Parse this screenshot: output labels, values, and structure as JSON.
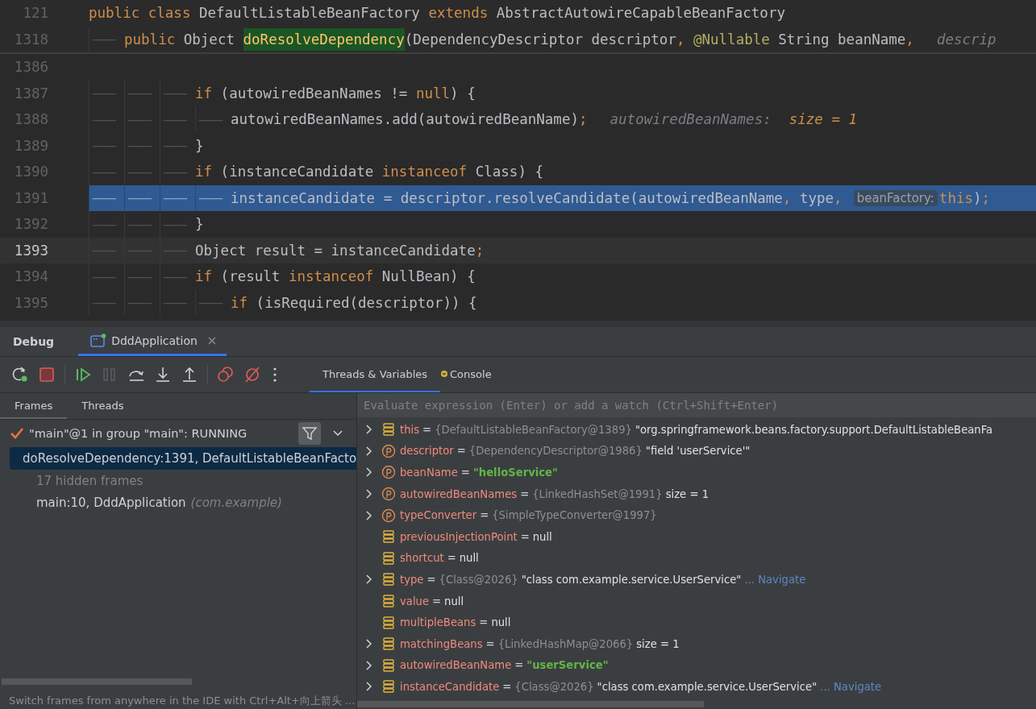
{
  "editor": {
    "sticky_lines": [
      {
        "number": "121",
        "tokens": [
          {
            "kind": "kw",
            "text": "public class "
          },
          {
            "kind": "plain",
            "text": "DefaultListableBeanFactory "
          },
          {
            "kind": "kw",
            "text": "extends "
          },
          {
            "kind": "plain",
            "text": "AbstractAutowireCapableBeanFactory"
          }
        ]
      },
      {
        "number": "1318",
        "indent_marks": [
          "——"
        ],
        "tokens": [
          {
            "kind": "kw",
            "text": "public "
          },
          {
            "kind": "plain",
            "text": "Object "
          },
          {
            "kind": "decl",
            "text": "doResolveDependency"
          },
          {
            "kind": "plain",
            "text": "(DependencyDescriptor descriptor"
          },
          {
            "kind": "punct",
            "text": ","
          },
          {
            "kind": "annot",
            "text": " @Nullable"
          },
          {
            "kind": "plain",
            "text": " String beanName"
          },
          {
            "kind": "punct",
            "text": ","
          },
          {
            "kind": "hint",
            "text": "descrip"
          }
        ]
      }
    ],
    "lines": [
      {
        "number": "1386",
        "current": false,
        "selected": false
      },
      {
        "number": "1387",
        "indent_marks": [
          "——",
          "——",
          "——"
        ],
        "current": false,
        "selected": false,
        "tokens": [
          {
            "kind": "kw",
            "text": "if "
          },
          {
            "kind": "plain",
            "text": "(autowiredBeanNames != "
          },
          {
            "kind": "kw",
            "text": "null"
          },
          {
            "kind": "plain",
            "text": ") {"
          }
        ]
      },
      {
        "number": "1388",
        "indent_marks": [
          "——",
          "——",
          "——",
          "——"
        ],
        "current": false,
        "selected": false,
        "tokens": [
          {
            "kind": "plain",
            "text": "autowiredBeanNames.add(autowiredBeanName)"
          },
          {
            "kind": "punct",
            "text": ";"
          },
          {
            "kind": "hint",
            "text": "autowiredBeanNames:"
          },
          {
            "kind": "hintval",
            "text": "size = 1"
          }
        ]
      },
      {
        "number": "1389",
        "indent_marks": [
          "——",
          "——",
          "——"
        ],
        "current": false,
        "selected": false,
        "tokens": [
          {
            "kind": "plain",
            "text": "}"
          }
        ]
      },
      {
        "number": "1390",
        "indent_marks": [
          "——",
          "——",
          "——"
        ],
        "current": false,
        "selected": false,
        "tokens": [
          {
            "kind": "kw",
            "text": "if "
          },
          {
            "kind": "plain",
            "text": "(instanceCandidate "
          },
          {
            "kind": "kw",
            "text": "instanceof "
          },
          {
            "kind": "plain",
            "text": "Class) {"
          }
        ]
      },
      {
        "number": "1391",
        "indent_marks": [
          "——",
          "——",
          "——",
          "——"
        ],
        "current": false,
        "selected": true,
        "tokens": [
          {
            "kind": "plain",
            "text": "instanceCandidate = descriptor.resolveCandidate(autowiredBeanName"
          },
          {
            "kind": "punct",
            "text": ","
          },
          {
            "kind": "plain",
            "text": " type"
          },
          {
            "kind": "punct",
            "text": ","
          },
          {
            "kind": "chip",
            "text": "beanFactory:"
          },
          {
            "kind": "kw",
            "text": "this"
          },
          {
            "kind": "plain",
            "text": ")"
          },
          {
            "kind": "punct",
            "text": ";"
          }
        ]
      },
      {
        "number": "1392",
        "indent_marks": [
          "——",
          "——",
          "——"
        ],
        "current": false,
        "selected": false,
        "tokens": [
          {
            "kind": "plain",
            "text": "}"
          }
        ]
      },
      {
        "number": "1393",
        "indent_marks": [
          "——",
          "——",
          "——"
        ],
        "current": true,
        "selected": false,
        "tokens": [
          {
            "kind": "plain",
            "text": "Object result = instanceCandidate"
          },
          {
            "kind": "punct",
            "text": ";"
          }
        ]
      },
      {
        "number": "1394",
        "indent_marks": [
          "——",
          "——",
          "——"
        ],
        "current": false,
        "selected": false,
        "tokens": [
          {
            "kind": "kw",
            "text": "if "
          },
          {
            "kind": "plain",
            "text": "(result "
          },
          {
            "kind": "kw",
            "text": "instanceof "
          },
          {
            "kind": "plain",
            "text": "NullBean) {"
          }
        ]
      },
      {
        "number": "1395",
        "indent_marks": [
          "——",
          "——",
          "——",
          "——"
        ],
        "current": false,
        "selected": false,
        "tokens": [
          {
            "kind": "kw",
            "text": "if "
          },
          {
            "kind": "plain",
            "text": "(isRequired(descriptor)) {"
          }
        ]
      }
    ]
  },
  "debug": {
    "title": "Debug",
    "session_tabs": [
      {
        "label": "DddApplication",
        "selected": true
      }
    ],
    "view_tabs": [
      {
        "label": "Threads & Variables",
        "selected": true
      },
      {
        "label": "Console",
        "selected": false
      }
    ],
    "frame_tabs": [
      {
        "label": "Frames",
        "selected": true
      },
      {
        "label": "Threads",
        "selected": false
      }
    ],
    "thread": "\"main\"@1 in group \"main\": RUNNING",
    "frames": [
      {
        "kind": "frame",
        "text": "doResolveDependency:1391, DefaultListableBeanFacto",
        "selected": true
      },
      {
        "kind": "hidden",
        "text": "17 hidden frames",
        "selected": false
      },
      {
        "kind": "frame",
        "text": "main:10, DddApplication",
        "package": "(com.example)",
        "selected": false
      }
    ],
    "hint": "Switch frames from anywhere in the IDE with Ctrl+Alt+向上箭头 ...",
    "eval_placeholder": "Evaluate expression (Enter) or add a watch (Ctrl+Shift+Enter)",
    "variables": [
      {
        "kind": "field",
        "expandable": true,
        "name": "this",
        "parts": [
          {
            "kind": "op",
            "text": "="
          },
          {
            "kind": "ref",
            "text": "{DefaultListableBeanFactory@1389}"
          },
          {
            "kind": "text",
            "text": "\"org.springframework.beans.factory.support.DefaultListableBeanFa"
          }
        ]
      },
      {
        "kind": "param",
        "expandable": true,
        "name": "descriptor",
        "parts": [
          {
            "kind": "op",
            "text": "="
          },
          {
            "kind": "ref",
            "text": "{DependencyDescriptor@1986}"
          },
          {
            "kind": "text",
            "text": "\"field 'userService'\""
          }
        ]
      },
      {
        "kind": "param",
        "expandable": true,
        "name": "beanName",
        "parts": [
          {
            "kind": "op",
            "text": "="
          },
          {
            "kind": "string",
            "text": "\"helloService\""
          }
        ]
      },
      {
        "kind": "param",
        "expandable": true,
        "name": "autowiredBeanNames",
        "parts": [
          {
            "kind": "op",
            "text": "="
          },
          {
            "kind": "ref",
            "text": "{LinkedHashSet@1991}"
          },
          {
            "kind": "text",
            "text": " size = 1"
          }
        ]
      },
      {
        "kind": "param",
        "expandable": true,
        "name": "typeConverter",
        "parts": [
          {
            "kind": "op",
            "text": "="
          },
          {
            "kind": "ref",
            "text": "{SimpleTypeConverter@1997}"
          }
        ]
      },
      {
        "kind": "field",
        "expandable": false,
        "name": "previousInjectionPoint",
        "parts": [
          {
            "kind": "op",
            "text": "="
          },
          {
            "kind": "text",
            "text": "null"
          }
        ]
      },
      {
        "kind": "field",
        "expandable": false,
        "name": "shortcut",
        "parts": [
          {
            "kind": "op",
            "text": "="
          },
          {
            "kind": "text",
            "text": "null"
          }
        ]
      },
      {
        "kind": "field",
        "expandable": true,
        "name": "type",
        "parts": [
          {
            "kind": "op",
            "text": "="
          },
          {
            "kind": "ref",
            "text": "{Class@2026}"
          },
          {
            "kind": "text",
            "text": "\"class com.example.service.UserService\""
          },
          {
            "kind": "link",
            "text": "... Navigate"
          }
        ]
      },
      {
        "kind": "field",
        "expandable": false,
        "name": "value",
        "parts": [
          {
            "kind": "op",
            "text": "="
          },
          {
            "kind": "text",
            "text": "null"
          }
        ]
      },
      {
        "kind": "field",
        "expandable": false,
        "name": "multipleBeans",
        "parts": [
          {
            "kind": "op",
            "text": "="
          },
          {
            "kind": "text",
            "text": "null"
          }
        ]
      },
      {
        "kind": "field",
        "expandable": true,
        "name": "matchingBeans",
        "parts": [
          {
            "kind": "op",
            "text": "="
          },
          {
            "kind": "ref",
            "text": "{LinkedHashMap@2066}"
          },
          {
            "kind": "text",
            "text": " size = 1"
          }
        ]
      },
      {
        "kind": "field",
        "expandable": true,
        "name": "autowiredBeanName",
        "parts": [
          {
            "kind": "op",
            "text": "="
          },
          {
            "kind": "string",
            "text": "\"userService\""
          }
        ]
      },
      {
        "kind": "field",
        "expandable": true,
        "name": "instanceCandidate",
        "parts": [
          {
            "kind": "op",
            "text": "="
          },
          {
            "kind": "ref",
            "text": "{Class@2026}"
          },
          {
            "kind": "text",
            "text": "\"class com.example.service.UserService\""
          },
          {
            "kind": "link",
            "text": "... Navigate"
          }
        ]
      }
    ]
  }
}
